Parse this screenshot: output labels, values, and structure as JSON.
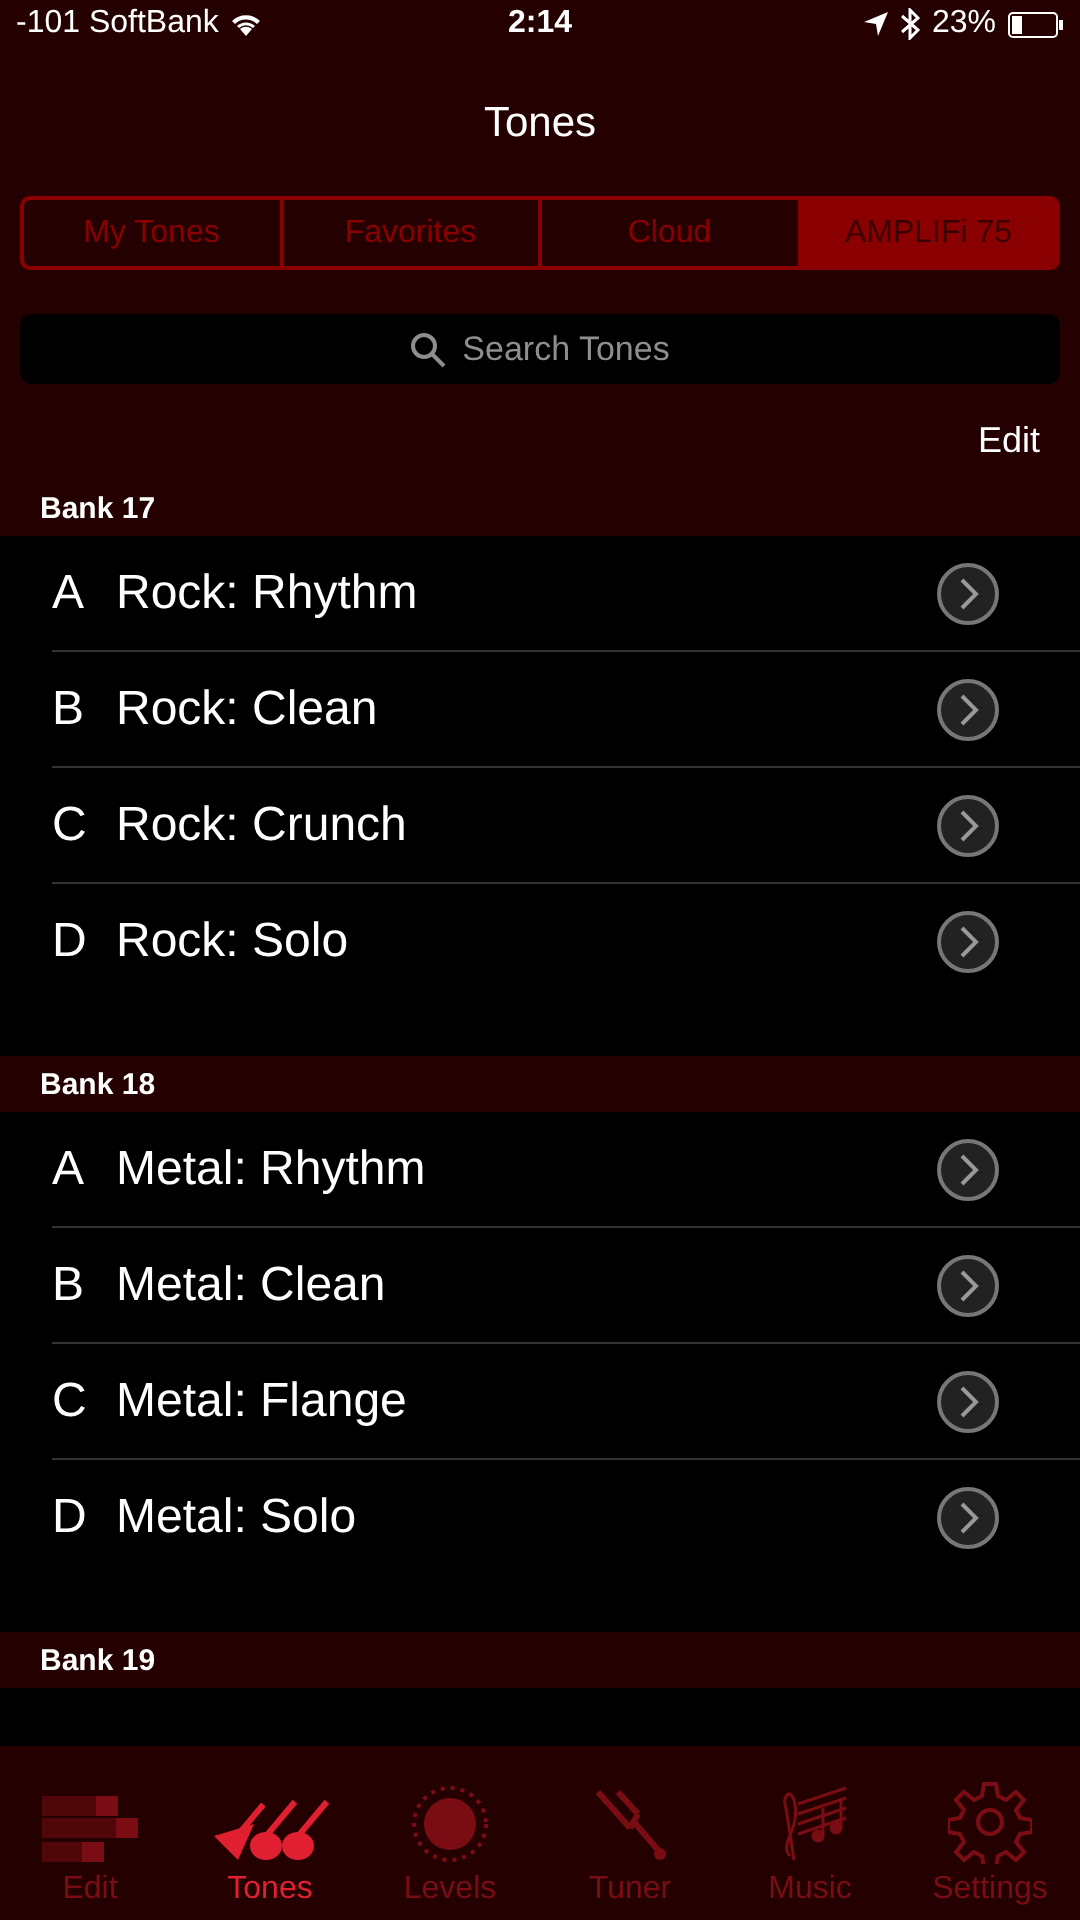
{
  "status_bar": {
    "carrier": "-101 SoftBank",
    "time": "2:14",
    "battery": "23%"
  },
  "title": "Tones",
  "segments": [
    {
      "label": "My Tones",
      "selected": false
    },
    {
      "label": "Favorites",
      "selected": false
    },
    {
      "label": "Cloud",
      "selected": false
    },
    {
      "label": "AMPLIFi 75",
      "selected": true
    }
  ],
  "search": {
    "placeholder": "Search Tones"
  },
  "edit_button": "Edit",
  "banks": [
    {
      "title": "Bank 17",
      "tones": [
        {
          "slot": "A",
          "name": "Rock: Rhythm"
        },
        {
          "slot": "B",
          "name": "Rock: Clean"
        },
        {
          "slot": "C",
          "name": "Rock: Crunch"
        },
        {
          "slot": "D",
          "name": "Rock: Solo"
        }
      ]
    },
    {
      "title": "Bank 18",
      "tones": [
        {
          "slot": "A",
          "name": "Metal: Rhythm"
        },
        {
          "slot": "B",
          "name": "Metal: Clean"
        },
        {
          "slot": "C",
          "name": "Metal: Flange"
        },
        {
          "slot": "D",
          "name": "Metal: Solo"
        }
      ]
    },
    {
      "title": "Bank 19"
    }
  ],
  "tab_bar": [
    {
      "label": "Edit",
      "kind": "edit",
      "selected": false
    },
    {
      "label": "Tones",
      "kind": "tones",
      "selected": true
    },
    {
      "label": "Levels",
      "kind": "levels",
      "selected": false
    },
    {
      "label": "Tuner",
      "kind": "tuner",
      "selected": false
    },
    {
      "label": "Music",
      "kind": "music",
      "selected": false
    },
    {
      "label": "Settings",
      "kind": "settings",
      "selected": false
    }
  ]
}
